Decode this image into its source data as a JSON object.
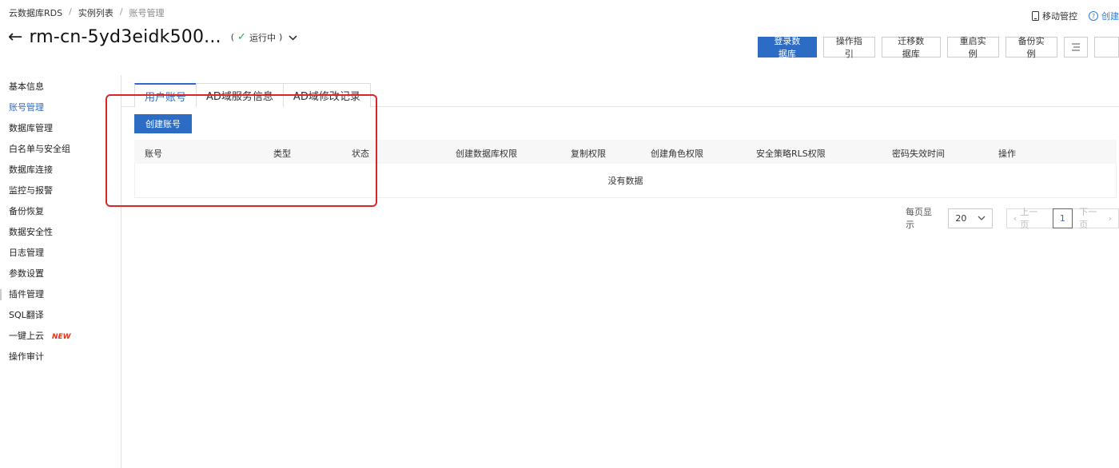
{
  "breadcrumb": {
    "items": [
      "云数据库RDS",
      "实例列表",
      "账号管理"
    ],
    "sep": "/"
  },
  "top_right": {
    "mobile": "移动管控",
    "help": "创建"
  },
  "header": {
    "back": "←",
    "title": "rm-cn-5yd3eidk500...",
    "status": "运行中",
    "status_open": "(",
    "status_close": ")"
  },
  "actions": [
    "登录数据库",
    "操作指引",
    "迁移数据库",
    "重启实例",
    "备份实例"
  ],
  "sidebar": {
    "items": [
      "基本信息",
      "账号管理",
      "数据库管理",
      "白名单与安全组",
      "数据库连接",
      "监控与报警",
      "备份恢复",
      "数据安全性",
      "日志管理",
      "参数设置",
      "插件管理",
      "SQL翻译",
      "一键上云",
      "操作审计"
    ],
    "new_badge": "NEW"
  },
  "tabs": [
    "用户账号",
    "AD域服务信息",
    "AD域修改记录"
  ],
  "create_button": "创建账号",
  "table": {
    "columns": [
      "账号",
      "类型",
      "状态",
      "创建数据库权限",
      "复制权限",
      "创建角色权限",
      "安全策略RLS权限",
      "密码失效时间",
      "操作"
    ],
    "empty": "没有数据"
  },
  "pagination": {
    "page_size_label": "每页显示",
    "page_size": "20",
    "prev": "上一页",
    "current": "1",
    "next": "下一页"
  },
  "colors": {
    "accent": "#2c6cc4",
    "highlight": "#d92626",
    "success": "#28a745",
    "new": "#d9381e"
  }
}
